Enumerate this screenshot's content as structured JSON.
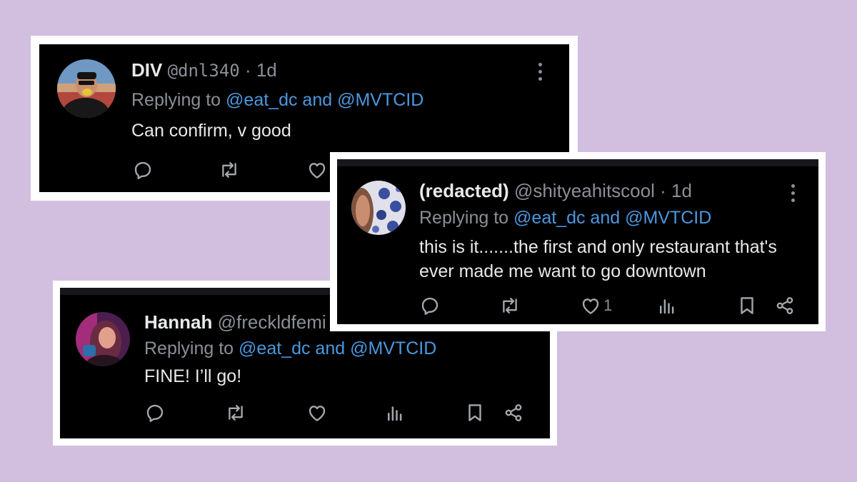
{
  "posts": [
    {
      "display_name": "DIV",
      "handle": "@dnl340",
      "time": "· 1d",
      "replying_prefix": "Replying to",
      "replying_mentions": "@eat_dc and @MVTCID",
      "text": "Can confirm, v good",
      "actions": [
        "reply-icon",
        "repost-icon",
        "like-icon"
      ]
    },
    {
      "display_name": "(redacted)",
      "handle": "@shityeahitscool",
      "time": "· 1d",
      "replying_prefix": "Replying to",
      "replying_mentions": "@eat_dc and @MVTCID",
      "text": "this is it.......the first and only restaurant that's ever made me want to go downtown",
      "like_count": "1",
      "actions": [
        "reply-icon",
        "repost-icon",
        "like-icon",
        "views-icon",
        "bookmark-icon",
        "share-icon"
      ]
    },
    {
      "display_name": "Hannah",
      "handle": "@freckldfemi",
      "replying_prefix": "Replying to",
      "replying_mentions": "@eat_dc and @MVTCID",
      "text": "FINE! I’ll go!",
      "actions": [
        "reply-icon",
        "repost-icon",
        "like-icon",
        "views-icon",
        "bookmark-icon",
        "share-icon"
      ]
    }
  ],
  "colors": {
    "background": "#d2bfdf",
    "card": "#000000",
    "frame": "#ffffff",
    "name": "#e7e9ea",
    "muted": "#8b9096",
    "mention": "#4b98df"
  }
}
